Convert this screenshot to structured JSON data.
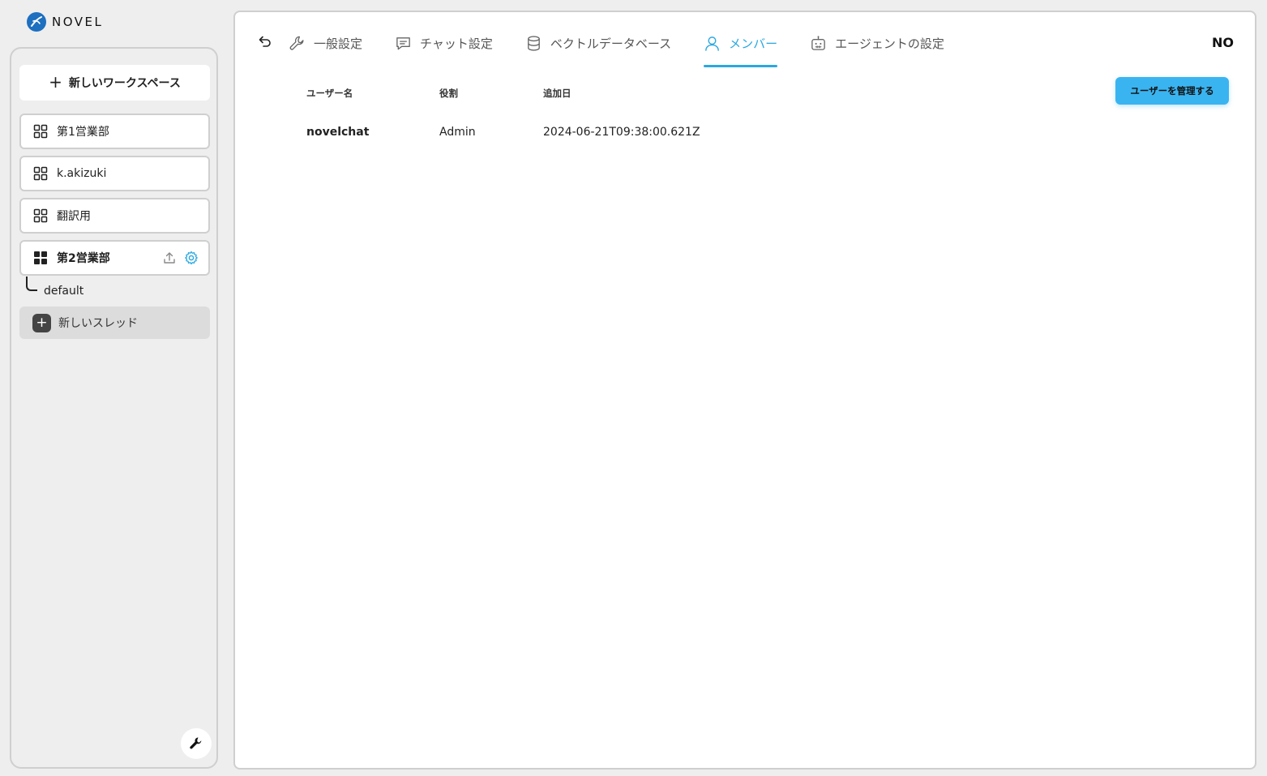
{
  "brand": {
    "name": "NOVEL",
    "color": "#1d6fc0"
  },
  "sidebar": {
    "new_workspace_label": "新しいワークスペース",
    "workspaces": [
      {
        "label": "第1営業部",
        "icon": "grid-icon",
        "active": false
      },
      {
        "label": "k.akizuki",
        "icon": "grid-icon",
        "active": false
      },
      {
        "label": "翻訳用",
        "icon": "grid-icon",
        "active": false
      },
      {
        "label": "第2営業部",
        "icon": "grid-filled-icon",
        "active": true
      }
    ],
    "active_workspace_actions": [
      "upload-icon",
      "gear-icon"
    ],
    "thread_label": "default",
    "new_thread_label": "新しいスレッド",
    "tools_icon": "wrench-icon"
  },
  "header": {
    "back_icon": "undo-arrow-icon",
    "tabs": [
      {
        "label": "一般設定",
        "icon": "wrench-icon",
        "active": false
      },
      {
        "label": "チャット設定",
        "icon": "chat-icon",
        "active": false
      },
      {
        "label": "ベクトルデータベース",
        "icon": "database-icon",
        "active": false
      },
      {
        "label": "メンバー",
        "icon": "user-icon",
        "active": true
      },
      {
        "label": "エージェントの設定",
        "icon": "robot-icon",
        "active": false
      }
    ],
    "user_initials": "NO"
  },
  "members": {
    "manage_button_label": "ユーザーを管理する",
    "columns": [
      "ユーザー名",
      "役割",
      "追加日"
    ],
    "rows": [
      {
        "username": "novelchat",
        "role": "Admin",
        "added": "2024-06-21T09:38:00.621Z"
      }
    ]
  },
  "colors": {
    "accent": "#2aa8e0",
    "button": "#3ab4f0",
    "background": "#eeeeee"
  }
}
